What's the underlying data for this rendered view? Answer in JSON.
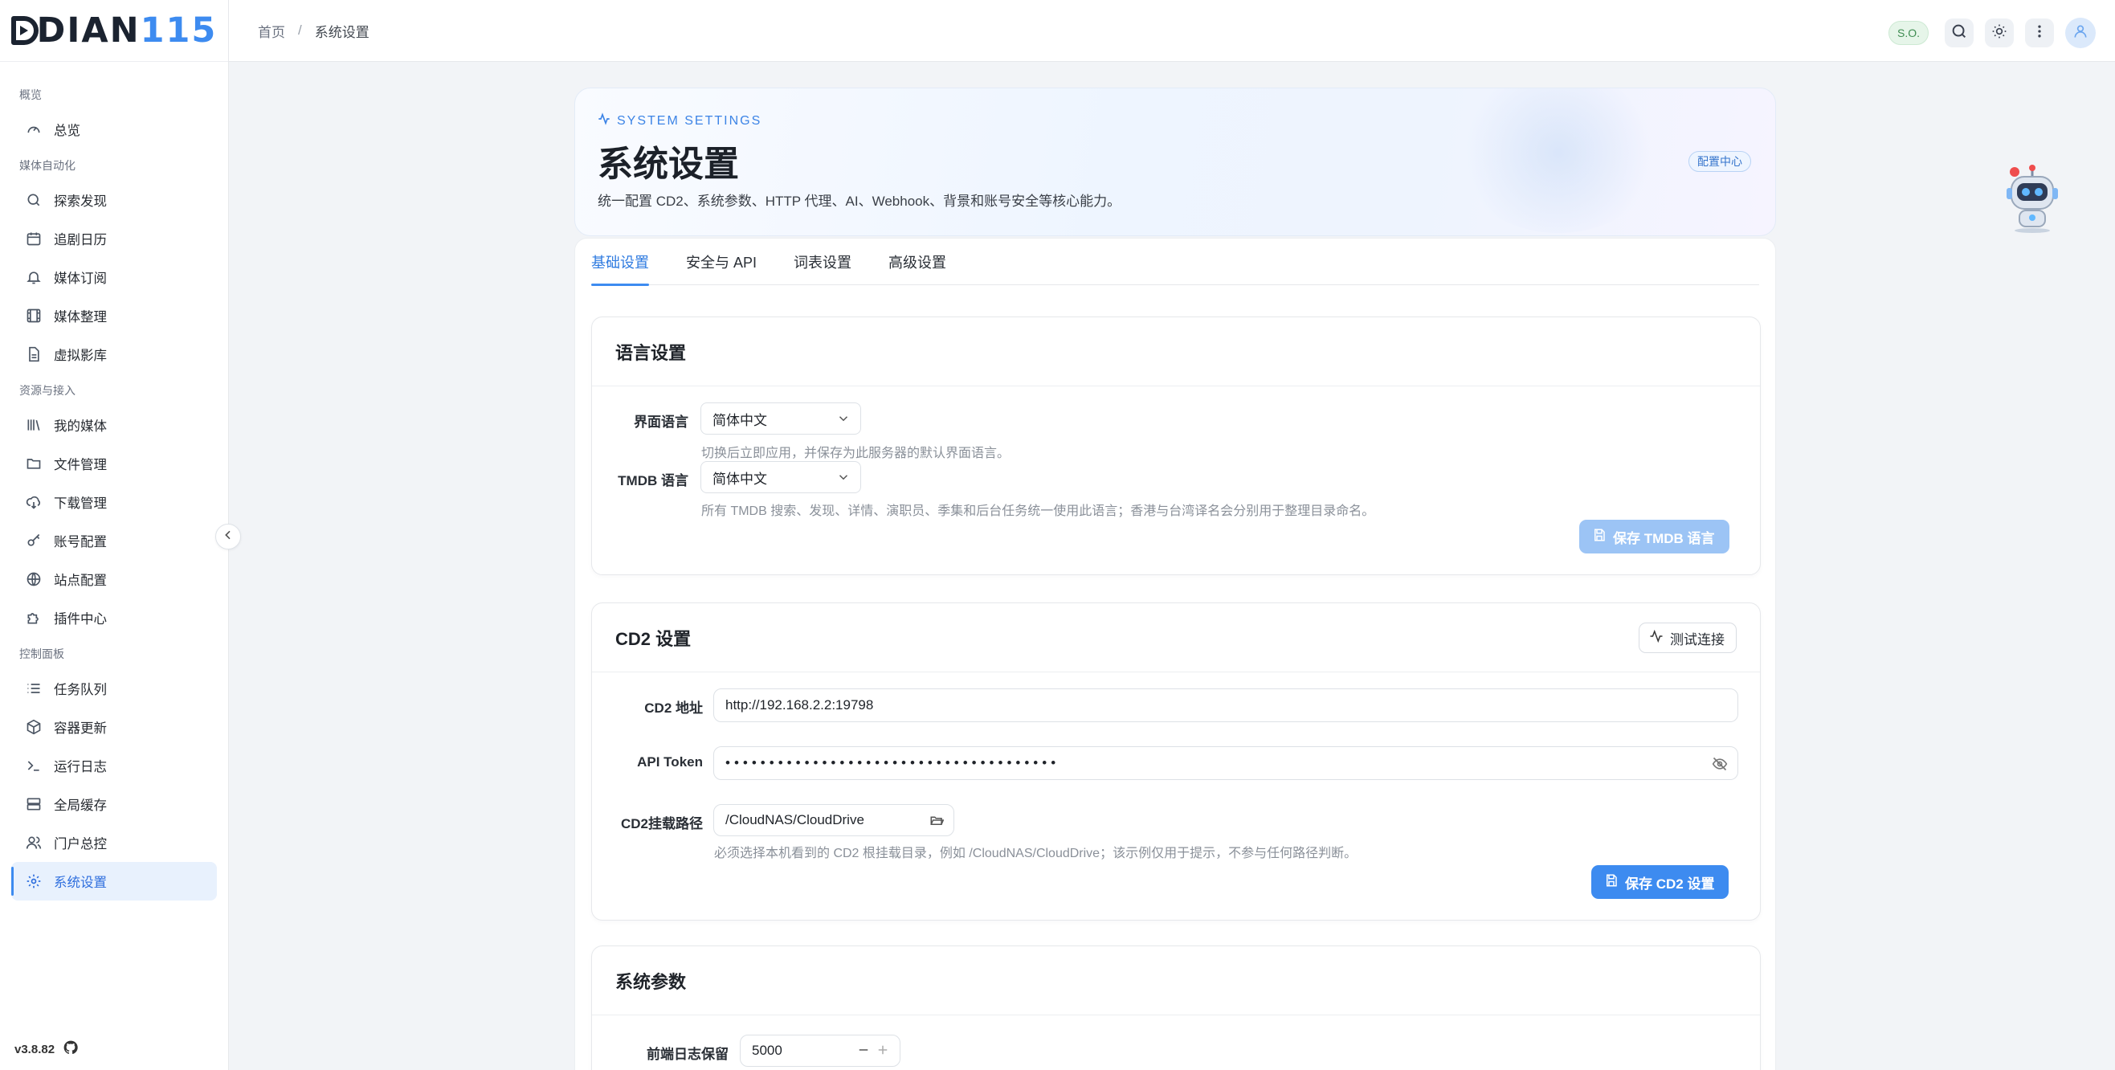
{
  "app": {
    "logo_text": "DIAN",
    "logo_num": "115",
    "version": "v3.8.82"
  },
  "sidebar": {
    "sections": [
      {
        "title": "概览",
        "items": [
          {
            "label": "总览",
            "icon": "gauge-icon"
          }
        ]
      },
      {
        "title": "媒体自动化",
        "items": [
          {
            "label": "探索发现",
            "icon": "search-icon"
          },
          {
            "label": "追剧日历",
            "icon": "calendar-icon"
          },
          {
            "label": "媒体订阅",
            "icon": "bell-icon"
          },
          {
            "label": "媒体整理",
            "icon": "film-icon"
          },
          {
            "label": "虚拟影库",
            "icon": "document-icon"
          }
        ]
      },
      {
        "title": "资源与接入",
        "items": [
          {
            "label": "我的媒体",
            "icon": "library-icon"
          },
          {
            "label": "文件管理",
            "icon": "folder-icon"
          },
          {
            "label": "下载管理",
            "icon": "cloud-download-icon"
          },
          {
            "label": "账号配置",
            "icon": "key-icon"
          },
          {
            "label": "站点配置",
            "icon": "globe-icon"
          },
          {
            "label": "插件中心",
            "icon": "puzzle-icon"
          }
        ]
      },
      {
        "title": "控制面板",
        "items": [
          {
            "label": "任务队列",
            "icon": "list-icon"
          },
          {
            "label": "容器更新",
            "icon": "box-icon"
          },
          {
            "label": "运行日志",
            "icon": "terminal-icon"
          },
          {
            "label": "全局缓存",
            "icon": "server-icon"
          },
          {
            "label": "门户总控",
            "icon": "users-icon"
          },
          {
            "label": "系统设置",
            "icon": "gear-icon",
            "active": true
          }
        ]
      }
    ]
  },
  "header": {
    "breadcrumb": {
      "home": "首页",
      "separator": "/",
      "current": "系统设置"
    },
    "badge": "S.O."
  },
  "hero": {
    "subtitle": "SYSTEM SETTINGS",
    "title": "系统设置",
    "description": "统一配置 CD2、系统参数、HTTP 代理、AI、Webhook、背景和账号安全等核心能力。",
    "badge": "配置中心"
  },
  "tabs": [
    {
      "label": "基础设置",
      "active": true
    },
    {
      "label": "安全与 API"
    },
    {
      "label": "词表设置"
    },
    {
      "label": "高级设置"
    }
  ],
  "language_card": {
    "title": "语言设置",
    "ui_lang_label": "界面语言",
    "ui_lang_value": "简体中文",
    "ui_lang_hint": "切换后立即应用，并保存为此服务器的默认界面语言。",
    "tmdb_lang_label": "TMDB 语言",
    "tmdb_lang_value": "简体中文",
    "tmdb_lang_hint": "所有 TMDB 搜索、发现、详情、演职员、季集和后台任务统一使用此语言；香港与台湾译名会分别用于整理目录命名。",
    "save_button": "保存 TMDB 语言"
  },
  "cd2_card": {
    "title": "CD2 设置",
    "test_button": "测试连接",
    "address_label": "CD2 地址",
    "address_value": "http://192.168.2.2:19798",
    "token_label": "API Token",
    "token_value": "••••••••••••••••••••••••••••••••••••••",
    "mount_label": "CD2挂载路径",
    "mount_value": "/CloudNAS/CloudDrive",
    "mount_hint": "必须选择本机看到的 CD2 根挂载目录，例如 /CloudNAS/CloudDrive；该示例仅用于提示，不参与任何路径判断。",
    "save_button": "保存 CD2 设置"
  },
  "params_card": {
    "title": "系统参数",
    "log_label": "前端日志保留",
    "log_value": "5000"
  },
  "colors": {
    "accent": "#3d8bf0",
    "active_bg": "#e8f1fd"
  }
}
